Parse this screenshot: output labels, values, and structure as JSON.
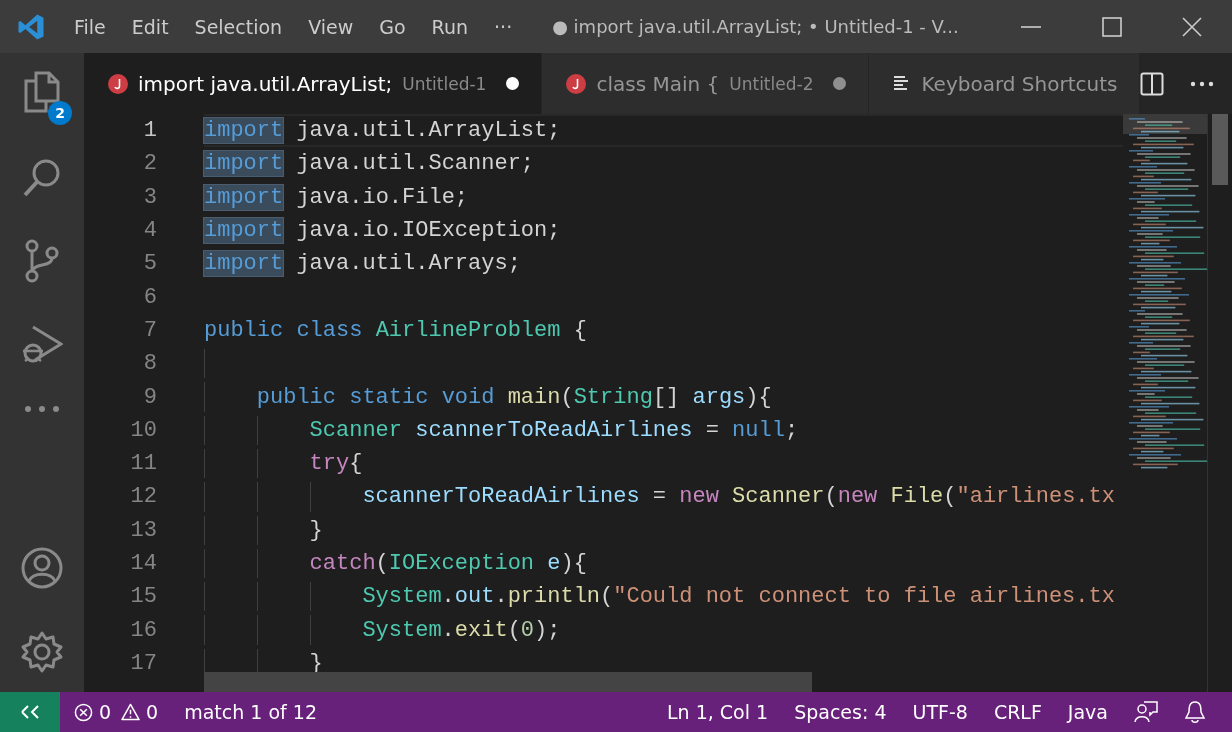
{
  "window": {
    "title": "● import java.util.ArrayList; • Untitled-1 - V..."
  },
  "menu": [
    "File",
    "Edit",
    "Selection",
    "View",
    "Go",
    "Run",
    "···"
  ],
  "activity_bar": {
    "explorer_badge": "2"
  },
  "tabs": [
    {
      "kind": "java",
      "title": "import java.util.ArrayList;",
      "description": "Untitled-1",
      "dirty": true,
      "selected": true
    },
    {
      "kind": "java",
      "title": "class Main {",
      "description": "Untitled-2",
      "dirty": true,
      "selected": false
    },
    {
      "kind": "shortcuts",
      "title": "Keyboard Shortcuts",
      "selected": false
    }
  ],
  "editor": {
    "lines": [
      {
        "number": "1",
        "current": true,
        "tokens": [
          {
            "text": "import",
            "kind": "keyword",
            "match": true
          },
          {
            "text": " java.util.ArrayList;",
            "kind": "plain",
            "match": false
          }
        ]
      },
      {
        "number": "2",
        "current": false,
        "tokens": [
          {
            "text": "import",
            "kind": "keyword",
            "match": true
          },
          {
            "text": " java.util.Scanner;",
            "kind": "plain",
            "match": false
          }
        ]
      },
      {
        "number": "3",
        "current": false,
        "tokens": [
          {
            "text": "import",
            "kind": "keyword",
            "match": true
          },
          {
            "text": " java.io.File;",
            "kind": "plain",
            "match": false
          }
        ]
      },
      {
        "number": "4",
        "current": false,
        "tokens": [
          {
            "text": "import",
            "kind": "keyword",
            "match": true
          },
          {
            "text": " java.io.IOException;",
            "kind": "plain",
            "match": false
          }
        ]
      },
      {
        "number": "5",
        "current": false,
        "tokens": [
          {
            "text": "import",
            "kind": "keyword",
            "match": true
          },
          {
            "text": " java.util.Arrays;",
            "kind": "plain",
            "match": false
          }
        ]
      },
      {
        "number": "6",
        "current": false
      },
      {
        "number": "7",
        "current": false,
        "tokens": [
          {
            "text": "public class ",
            "kind": "keyword",
            "match": false
          },
          {
            "text": "AirlineProblem",
            "kind": "type",
            "match": false
          },
          {
            "text": " {",
            "kind": "plain",
            "match": false
          }
        ]
      },
      {
        "number": "8",
        "current": false
      },
      {
        "number": "9",
        "current": false,
        "tokens": [
          {
            "text": "    public static void ",
            "kind": "keyword",
            "match": false
          },
          {
            "text": "main",
            "kind": "function",
            "match": false
          },
          {
            "text": "(",
            "kind": "plain",
            "match": false
          },
          {
            "text": "String",
            "kind": "type",
            "match": false
          },
          {
            "text": "[] ",
            "kind": "plain",
            "match": false
          },
          {
            "text": "args",
            "kind": "variable",
            "match": false
          },
          {
            "text": "){",
            "kind": "plain",
            "match": false
          }
        ]
      },
      {
        "number": "10",
        "current": false,
        "tokens": [
          {
            "text": "        Scanner",
            "kind": "type",
            "match": false
          },
          {
            "text": " scannerToReadAirlines",
            "kind": "variable",
            "match": false
          },
          {
            "text": " = ",
            "kind": "plain",
            "match": false
          },
          {
            "text": "null",
            "kind": "keyword",
            "match": false
          },
          {
            "text": ";",
            "kind": "plain",
            "match": false
          }
        ]
      },
      {
        "number": "11",
        "current": false,
        "tokens": [
          {
            "text": "        try",
            "kind": "control",
            "match": false
          },
          {
            "text": "{",
            "kind": "plain",
            "match": false
          }
        ]
      },
      {
        "number": "12",
        "current": false,
        "tokens": [
          {
            "text": "            scannerToReadAirlines",
            "kind": "variable",
            "match": false
          },
          {
            "text": " = ",
            "kind": "plain",
            "match": false
          },
          {
            "text": "new",
            "kind": "control",
            "match": false
          },
          {
            "text": " Scanner",
            "kind": "function",
            "match": false
          },
          {
            "text": "(",
            "kind": "plain",
            "match": false
          },
          {
            "text": "new",
            "kind": "control",
            "match": false
          },
          {
            "text": " File",
            "kind": "function",
            "match": false
          },
          {
            "text": "(",
            "kind": "plain",
            "match": false
          },
          {
            "text": "\"airlines.tx",
            "kind": "string",
            "match": false
          }
        ]
      },
      {
        "number": "13",
        "current": false,
        "tokens": [
          {
            "text": "        }",
            "kind": "plain",
            "match": false
          }
        ]
      },
      {
        "number": "14",
        "current": false,
        "tokens": [
          {
            "text": "        catch",
            "kind": "control",
            "match": false
          },
          {
            "text": "(",
            "kind": "plain",
            "match": false
          },
          {
            "text": "IOException",
            "kind": "type",
            "match": false
          },
          {
            "text": " e",
            "kind": "variable",
            "match": false
          },
          {
            "text": "){",
            "kind": "plain",
            "match": false
          }
        ]
      },
      {
        "number": "15",
        "current": false,
        "tokens": [
          {
            "text": "            System",
            "kind": "type",
            "match": false
          },
          {
            "text": ".",
            "kind": "plain",
            "match": false
          },
          {
            "text": "out",
            "kind": "variable",
            "match": false
          },
          {
            "text": ".",
            "kind": "plain",
            "match": false
          },
          {
            "text": "println",
            "kind": "function",
            "match": false
          },
          {
            "text": "(",
            "kind": "plain",
            "match": false
          },
          {
            "text": "\"Could not connect to file airlines.tx",
            "kind": "string",
            "match": false
          }
        ]
      },
      {
        "number": "16",
        "current": false,
        "tokens": [
          {
            "text": "            System",
            "kind": "type",
            "match": false
          },
          {
            "text": ".",
            "kind": "plain",
            "match": false
          },
          {
            "text": "exit",
            "kind": "function",
            "match": false
          },
          {
            "text": "(",
            "kind": "plain",
            "match": false
          },
          {
            "text": "0",
            "kind": "number",
            "match": false
          },
          {
            "text": ");",
            "kind": "plain",
            "match": false
          }
        ]
      },
      {
        "number": "17",
        "current": false,
        "tokens": [
          {
            "text": "        }",
            "kind": "plain",
            "match": false
          }
        ]
      }
    ]
  },
  "status_bar": {
    "errors": "0",
    "warnings": "0",
    "find": "match 1 of 12",
    "items": [
      "Ln 1, Col 1",
      "Spaces: 4",
      "UTF-8",
      "CRLF",
      "Java"
    ]
  }
}
